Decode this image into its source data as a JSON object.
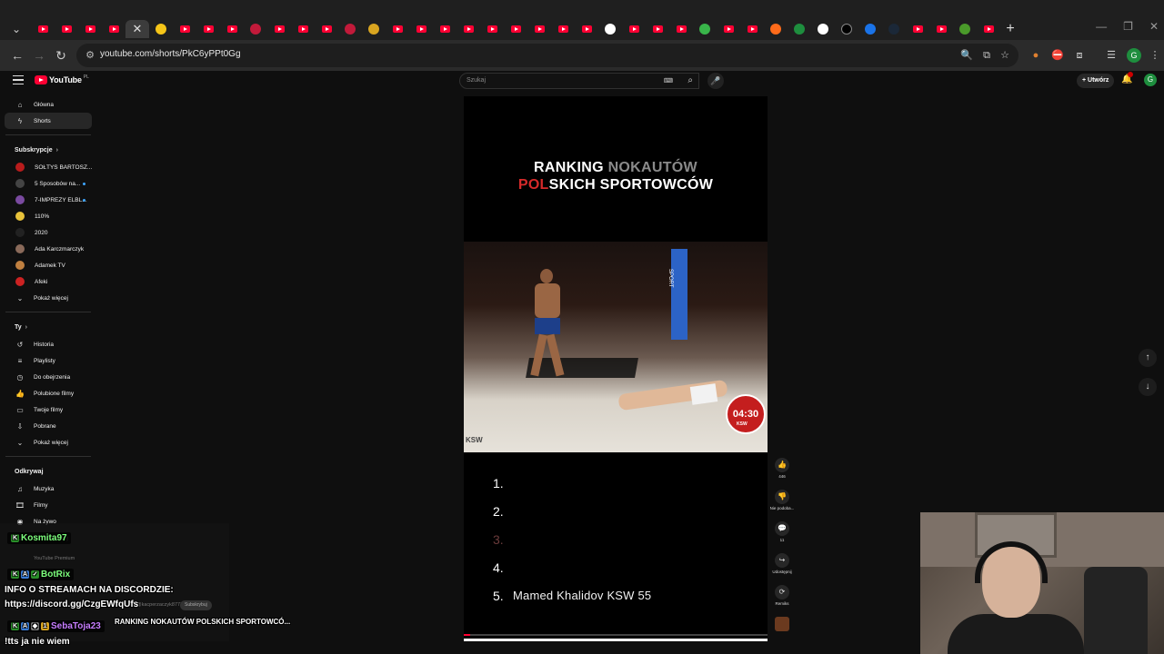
{
  "browser": {
    "url": "youtube.com/shorts/PkC6yPPt0Gg",
    "profile_initial": "G"
  },
  "youtube": {
    "logo_text": "YouTube",
    "logo_country": "PL",
    "search_placeholder": "Szukaj",
    "create_label": "Utwórz",
    "avatar_initial": "G"
  },
  "sidebar": {
    "main": [
      {
        "label": "Główna",
        "icon": "home-icon"
      },
      {
        "label": "Shorts",
        "icon": "shorts-icon"
      }
    ],
    "subscriptions_header": "Subskrypcje",
    "subscriptions": [
      {
        "label": "SOŁTYS BARTOSZ...",
        "color": "#b81c1c",
        "dot": false
      },
      {
        "label": "5 Sposobów na...",
        "color": "#444444",
        "dot": true
      },
      {
        "label": "7-IMPREZY ELBL...",
        "color": "#7a4aa0",
        "dot": true
      },
      {
        "label": "110%",
        "color": "#e8c23a",
        "dot": false
      },
      {
        "label": "2020",
        "color": "#222222",
        "dot": false
      },
      {
        "label": "Ada Karczmarczyk",
        "color": "#8a6a5a",
        "dot": false
      },
      {
        "label": "Adamek TV",
        "color": "#c08040",
        "dot": false
      },
      {
        "label": "Afeki",
        "color": "#cc2222",
        "dot": false
      }
    ],
    "show_more": "Pokaż więcej",
    "you_header": "Ty",
    "you_items": [
      {
        "label": "Historia",
        "icon": "history-icon"
      },
      {
        "label": "Playlisty",
        "icon": "playlist-icon"
      },
      {
        "label": "Do obejrzenia",
        "icon": "watch-later-icon"
      },
      {
        "label": "Polubione filmy",
        "icon": "like-icon"
      },
      {
        "label": "Twoje filmy",
        "icon": "your-videos-icon"
      },
      {
        "label": "Pobrane",
        "icon": "download-icon"
      },
      {
        "label": "Pokaż więcej",
        "icon": "chevron-down-icon"
      }
    ],
    "explore_header": "Odkrywaj",
    "explore_items": [
      {
        "label": "Muzyka",
        "icon": "music-icon"
      },
      {
        "label": "Filmy",
        "icon": "film-icon"
      },
      {
        "label": "Na żywo",
        "icon": "live-icon"
      },
      {
        "label": "Pokaż więcej",
        "icon": "chevron-down-icon"
      }
    ]
  },
  "short": {
    "title_line1_a": "RANKING",
    "title_line1_b": "NOKAUTÓW",
    "title_line2_a": "POL",
    "title_line2_b": "SKICH SPORTOWCÓW",
    "cage_text": "SPORT",
    "timer": "04:30",
    "timer_sub": "KSW",
    "ring_text": "KSW",
    "ranking": [
      {
        "num": "1.",
        "name": "",
        "dim": false
      },
      {
        "num": "2.",
        "name": "",
        "dim": false
      },
      {
        "num": "3.",
        "name": "",
        "dim": true
      },
      {
        "num": "4.",
        "name": "",
        "dim": false
      },
      {
        "num": "5.",
        "name": "Mamed Khalidov KSW 55",
        "dim": false
      }
    ],
    "progress_fraction": 0.02
  },
  "actions": [
    {
      "icon": "like-icon",
      "label": "446",
      "glyph": "👍"
    },
    {
      "icon": "dislike-icon",
      "label": "Nie podoba...",
      "glyph": "👎"
    },
    {
      "icon": "comment-icon",
      "label": "11",
      "glyph": "💬"
    },
    {
      "icon": "share-icon",
      "label": "Udostępnij",
      "glyph": "↪"
    },
    {
      "icon": "remix-icon",
      "label": "Remiks",
      "glyph": "⟳"
    }
  ],
  "stream_overlay": {
    "chat": [
      {
        "user": "Kosmita97",
        "color": "#7dff7d",
        "text": ""
      },
      {
        "user": "BotRix",
        "color": "#7dff7d",
        "text": ""
      },
      {
        "user": "",
        "color": "#ffffff",
        "text": "INFO O STREAMACH NA DISCORDZIE:"
      },
      {
        "user": "",
        "color": "#ffffff",
        "text": "https://discord.gg/CzgEWfqUfs"
      },
      {
        "user": "SebaToja23",
        "color": "#c77dff",
        "text": "RANKING NOKAUTÓW POLSKICH SPORTOWCÓ..."
      },
      {
        "user": "",
        "color": "#ffffff",
        "text": "!tts ja nie wiem"
      }
    ],
    "faded_premium": "YouTube Premium",
    "faded_channel": "@kacperzaczyk8773",
    "subscribe_label": "Subskrybuj"
  }
}
